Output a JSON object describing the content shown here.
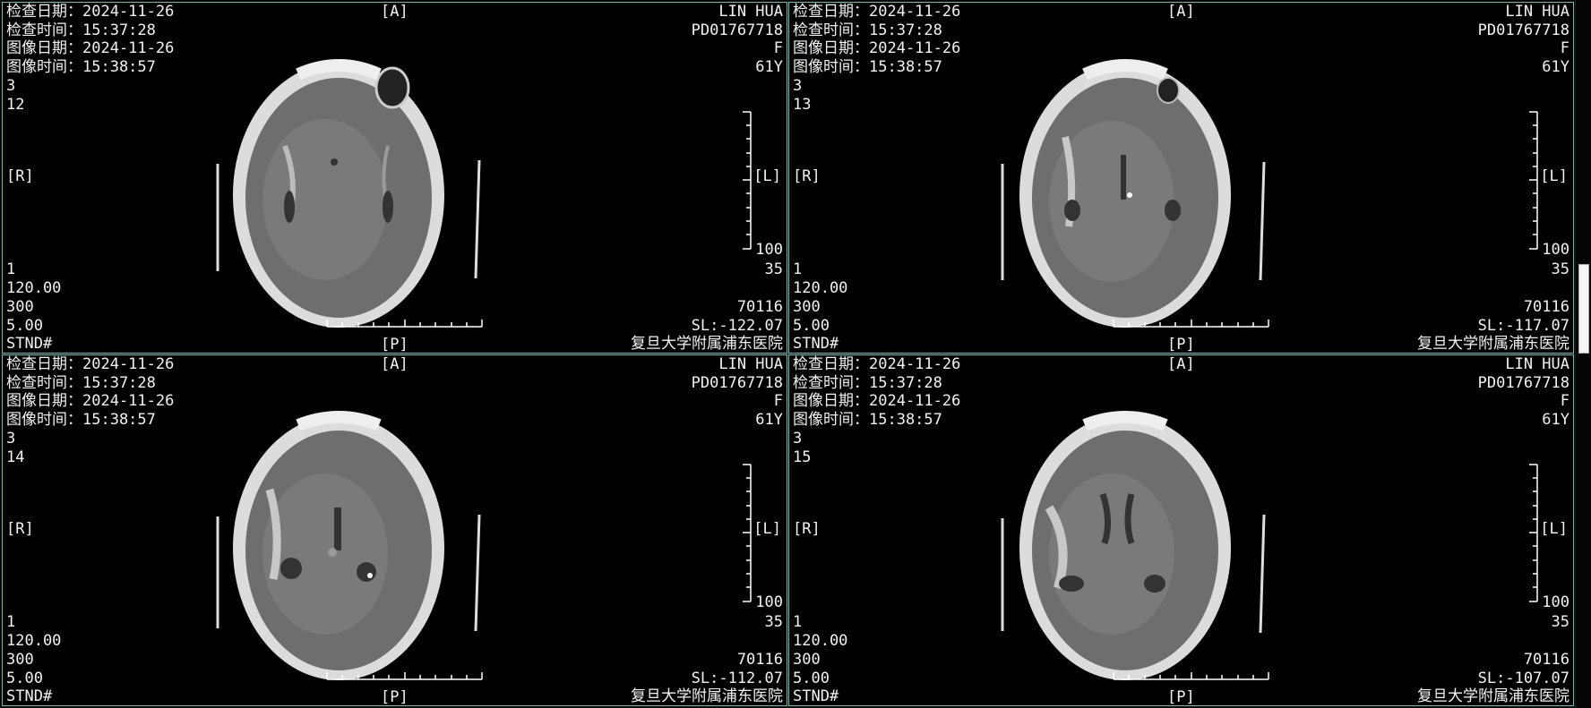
{
  "hospital": "复旦大学附属浦东医院",
  "patient": {
    "name": "LIN HUA",
    "id": "PD01767718",
    "sex": "F",
    "age": "61Y"
  },
  "labels": {
    "exam_date": "检查日期：2024-11-26",
    "exam_time": "检查时间：15:37:28",
    "image_date": "图像日期：2024-11-26",
    "image_time": "图像时间：15:38:57",
    "anterior": "[A]",
    "posterior": "[P]",
    "right": "[R]",
    "left": "[L]",
    "series": "3",
    "scale_max": "100",
    "window_zero": "1",
    "window_level": "35",
    "kv": "120.00",
    "ma": "300",
    "thickness": "5.00",
    "kernel": "STND#",
    "dose": "70116"
  },
  "viewports": [
    {
      "image_number": "12",
      "slice_location": "SL:-122.07",
      "active": false
    },
    {
      "image_number": "13",
      "slice_location": "SL:-117.07",
      "active": false
    },
    {
      "image_number": "14",
      "slice_location": "SL:-112.07",
      "active": false
    },
    {
      "image_number": "15",
      "slice_location": "SL:-107.07",
      "active": false
    }
  ],
  "icons": {
    "scan_image": "ct-brain-axial-icon",
    "ruler": "ruler-scale-icon"
  },
  "colors": {
    "viewport_border": "#7fb3b0",
    "background": "#000000",
    "overlay_text": "#f2f2f2"
  }
}
